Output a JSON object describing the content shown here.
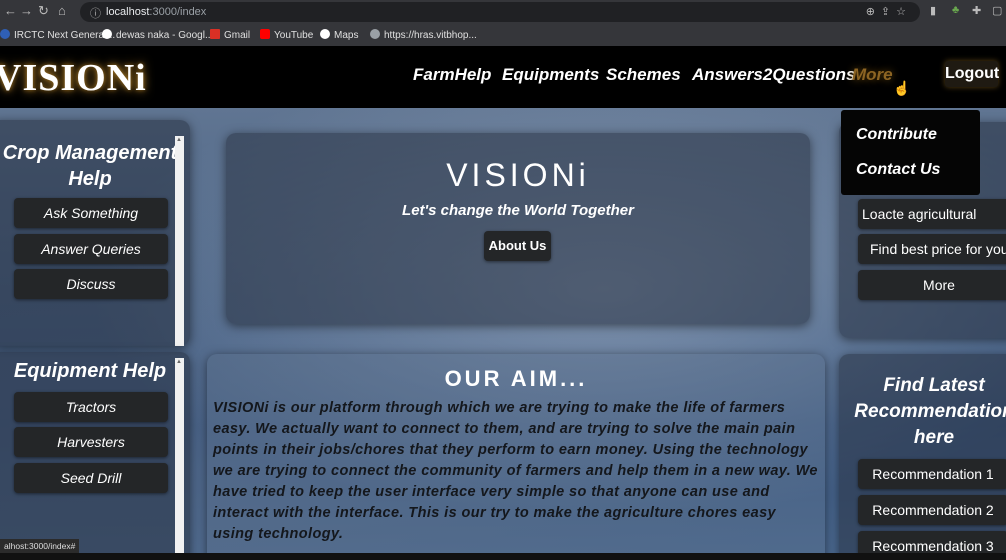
{
  "browser": {
    "url_host": "localhost",
    "url_path": ":3000/index",
    "bookmarks": [
      {
        "label": "IRCTC Next Generat...",
        "color": "#2f5fb5"
      },
      {
        "label": "dewas naka - Googl...",
        "color": "#ffffff"
      },
      {
        "label": "Gmail",
        "color": "#d93025"
      },
      {
        "label": "YouTube",
        "color": "#ff0000"
      },
      {
        "label": "Maps",
        "color": "#ffffff"
      },
      {
        "label": "https://hras.vitbhop...",
        "color": "#9aa0a6"
      }
    ],
    "status_url": "alhost:3000/index#"
  },
  "nav": {
    "logo": "VISIONi",
    "links": [
      "FarmHelp",
      "Equipments",
      "Schemes",
      "Answers2Questions",
      "More"
    ],
    "logout": "Logout",
    "dropdown": [
      "Contribute",
      "Contact Us"
    ]
  },
  "crop_panel": {
    "title": "Crop Management Help",
    "buttons": [
      "Ask Something",
      "Answer Queries",
      "Discuss"
    ]
  },
  "equipment_panel": {
    "title": "Equipment Help",
    "buttons": [
      "Tractors",
      "Harvesters",
      "Seed Drill"
    ]
  },
  "hero": {
    "title": "VISIONi",
    "subtitle": "Let's change the World Together",
    "button": "About Us"
  },
  "right_panel": {
    "buttons": [
      "Loacte agricultural",
      "Find best price for you",
      "More"
    ]
  },
  "aim": {
    "title": "OUR AIM...",
    "text": "VISIONi is our platform through which we are trying to make the life of farmers easy. We actually want to connect to them, and are trying to solve the main pain points in their jobs/chores that they perform to earn money. Using the technology we are trying to connect the community of farmers and help them in a new way. We have tried to keep the user interface very simple so that anyone can use and interact with the interface. This is our try to make the agriculture chores easy using technology."
  },
  "recommendations": {
    "title": "Find Latest Recommendation here",
    "buttons": [
      "Recommendation 1",
      "Recommendation 2",
      "Recommendation 3"
    ]
  }
}
